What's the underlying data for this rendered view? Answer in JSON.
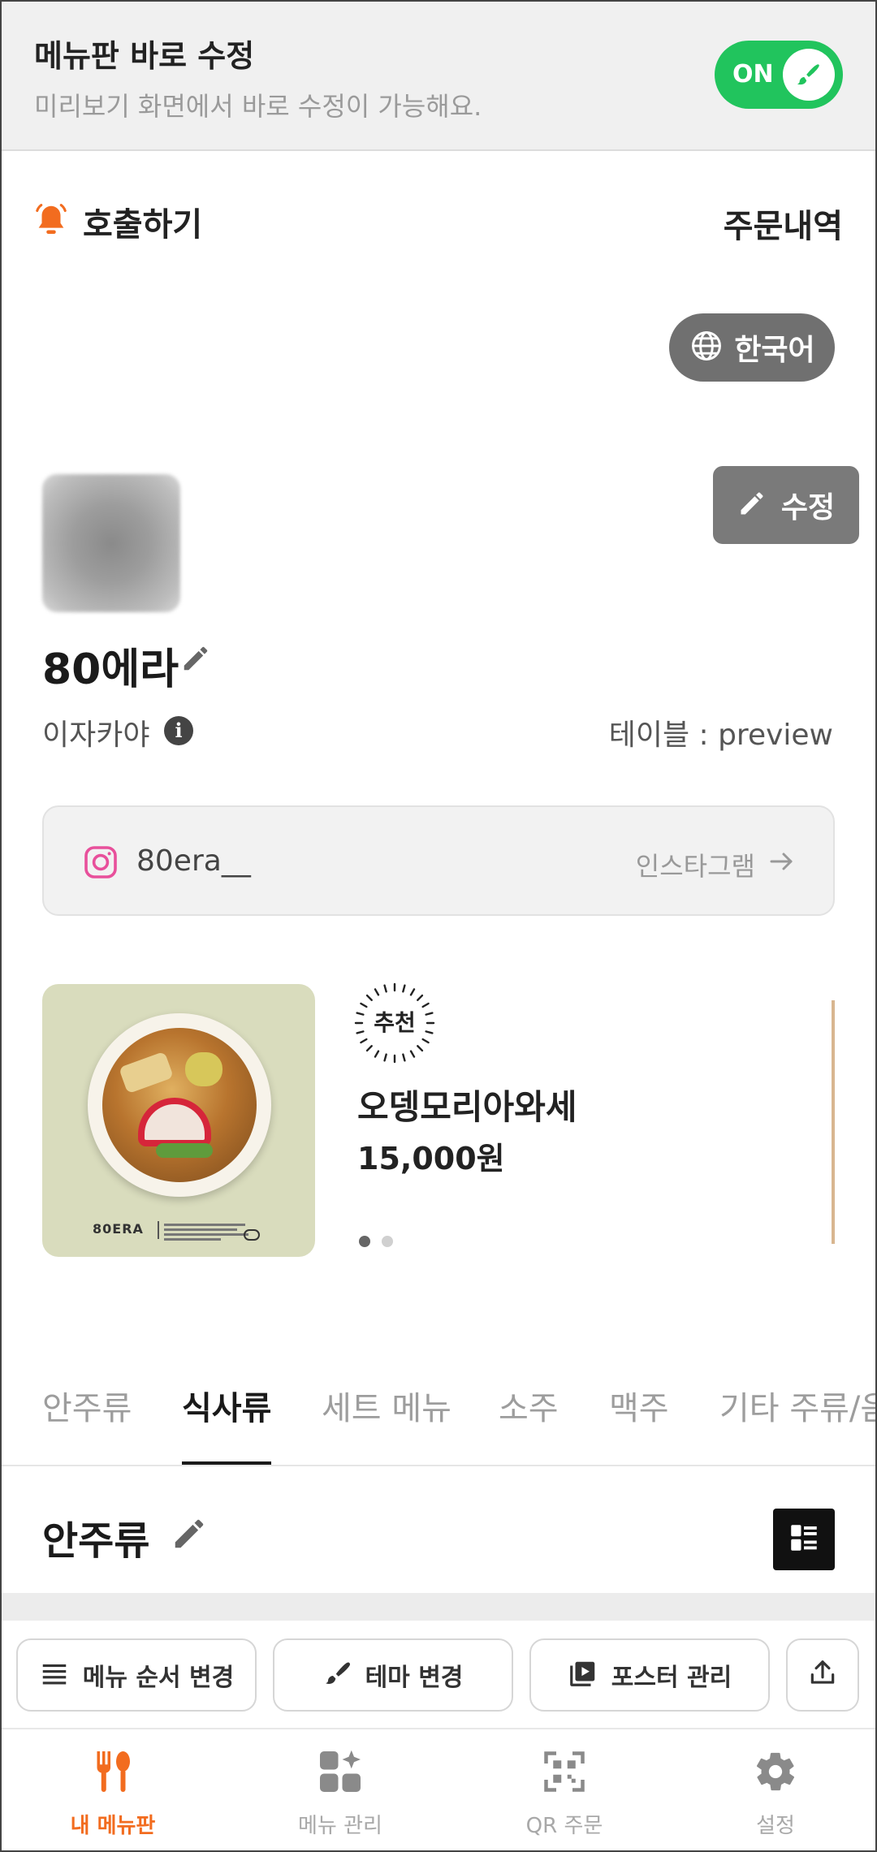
{
  "edit_banner": {
    "title": "메뉴판 바로 수정",
    "subtitle": "미리보기 화면에서 바로 수정이 가능해요.",
    "toggle_label": "ON"
  },
  "call_row": {
    "call_label": "호출하기",
    "orders_label": "주문내역"
  },
  "language": {
    "label": "한국어"
  },
  "store": {
    "edit_label": "수정",
    "name": "80에라",
    "category": "이자카야",
    "table_label": "테이블 : preview",
    "instagram_handle": "80era__",
    "instagram_link": "인스타그램"
  },
  "featured": {
    "badge": "추천",
    "name": "오뎅모리아와세",
    "price": "15,000원",
    "image_brand": "80ERA",
    "pages": 2,
    "active_page": 1
  },
  "tabs": [
    {
      "label": "안주류"
    },
    {
      "label": "식사류"
    },
    {
      "label": "세트 메뉴"
    },
    {
      "label": "소주"
    },
    {
      "label": "맥주"
    },
    {
      "label": "기타 주류/음료"
    }
  ],
  "active_tab": "식사류",
  "section": {
    "title": "안주류"
  },
  "actions": {
    "reorder": "메뉴 순서 변경",
    "theme": "테마 변경",
    "poster": "포스터 관리"
  },
  "bottom_nav": [
    {
      "label": "내 메뉴판",
      "icon": "fork-knife-icon",
      "active": true
    },
    {
      "label": "메뉴 관리",
      "icon": "grid-sparkle-icon",
      "active": false
    },
    {
      "label": "QR 주문",
      "icon": "qr-scan-icon",
      "active": false
    },
    {
      "label": "설정",
      "icon": "gear-icon",
      "active": false
    }
  ],
  "colors": {
    "accent": "#f26c1f",
    "toggle_on": "#21c45d",
    "pill_gray": "#707070"
  }
}
